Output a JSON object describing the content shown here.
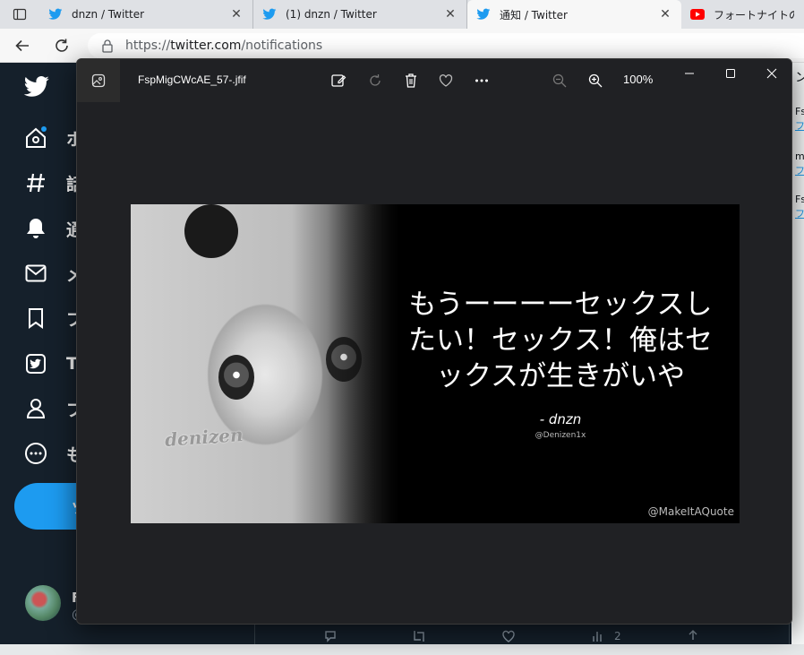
{
  "browser": {
    "tabs": [
      {
        "title": "dnzn / Twitter",
        "favicon": "twitter-icon"
      },
      {
        "title": "(1) dnzn / Twitter",
        "favicon": "twitter-icon"
      },
      {
        "title": "通知 / Twitter",
        "favicon": "twitter-icon",
        "active": true
      },
      {
        "title": "フォートナイトのロビー音",
        "favicon": "youtube-icon"
      }
    ],
    "url_scheme": "https://",
    "url_host": "twitter.com",
    "url_path": "/notifications"
  },
  "twitter": {
    "sidebar": [
      {
        "icon": "home-icon",
        "label": "ホ"
      },
      {
        "icon": "hashtag-icon",
        "label": "話"
      },
      {
        "icon": "bell-icon",
        "label": "通"
      },
      {
        "icon": "mail-icon",
        "label": "メ"
      },
      {
        "icon": "bookmark-icon",
        "label": "ブ"
      },
      {
        "icon": "twitter-blue-icon",
        "label": "Tw"
      },
      {
        "icon": "profile-icon",
        "label": "プ"
      },
      {
        "icon": "more-icon",
        "label": "も"
      }
    ],
    "tweet_button_label": "ツ",
    "account_initial": "F",
    "account_handle_fragment": "@",
    "right_column": [
      "Fs",
      "フ",
      "m",
      "フ",
      "Fs",
      "フ"
    ],
    "top_right_fragment": "ン",
    "retweet_count": "2"
  },
  "viewer": {
    "filename": "FspMigCWcAE_57-.jfif",
    "zoom": "100%",
    "image": {
      "quote": "もうーーーーセックスしたい！セックス！俺はセックスが生きがいや",
      "author": "- dnzn",
      "handle": "@Denizen1x",
      "watermark": "denizen",
      "credit": "@MakeItAQuote"
    }
  },
  "colors": {
    "twitter_bg": "#15202b",
    "twitter_blue": "#1d9bf0",
    "viewer_bg": "#202124",
    "youtube_red": "#ff0000"
  }
}
